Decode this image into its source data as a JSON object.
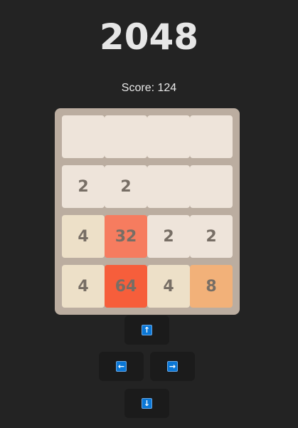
{
  "title": "2048",
  "score_text": "Score: 124",
  "board": {
    "rows": [
      [
        {
          "value": "",
          "bg": "#eee4da"
        },
        {
          "value": "",
          "bg": "#eee4da"
        },
        {
          "value": "",
          "bg": "#eee4da"
        },
        {
          "value": "",
          "bg": "#eee4da"
        }
      ],
      [
        {
          "value": "2",
          "bg": "#eee4da"
        },
        {
          "value": "2",
          "bg": "#eee4da"
        },
        {
          "value": "",
          "bg": "#eee4da"
        },
        {
          "value": "",
          "bg": "#eee4da"
        }
      ],
      [
        {
          "value": "4",
          "bg": "#ede0c8"
        },
        {
          "value": "32",
          "bg": "#f67c5f"
        },
        {
          "value": "2",
          "bg": "#eee4da"
        },
        {
          "value": "2",
          "bg": "#eee4da"
        }
      ],
      [
        {
          "value": "4",
          "bg": "#ede0c8"
        },
        {
          "value": "64",
          "bg": "#f65e3b"
        },
        {
          "value": "4",
          "bg": "#ede0c8"
        },
        {
          "value": "8",
          "bg": "#f2b179"
        }
      ]
    ]
  },
  "controls": {
    "up": {
      "label": "↑",
      "icon": "arrow-up-icon"
    },
    "left": {
      "label": "←",
      "icon": "arrow-left-icon"
    },
    "right": {
      "label": "→",
      "icon": "arrow-right-icon"
    },
    "down": {
      "label": "↓",
      "icon": "arrow-down-icon"
    }
  },
  "colors": {
    "background": "#232323",
    "board": "#bbada0",
    "tile_text": "#776e65",
    "key_blue": "#0a77d6"
  }
}
